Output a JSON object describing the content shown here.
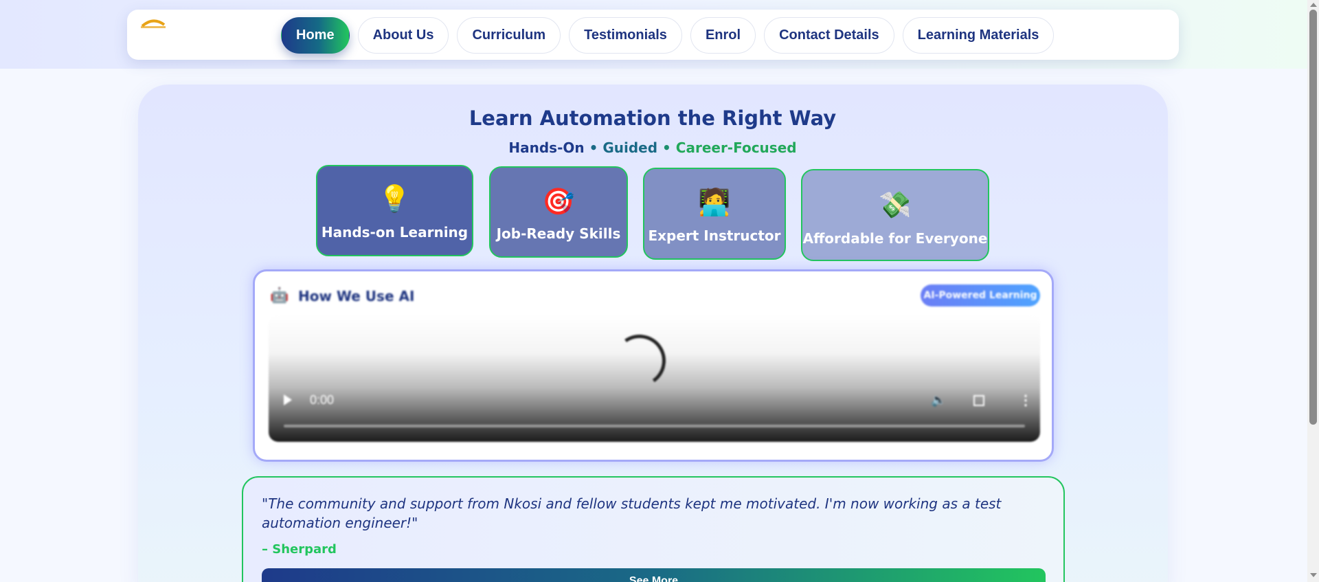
{
  "nav": {
    "items": [
      {
        "label": "Home",
        "active": true
      },
      {
        "label": "About Us"
      },
      {
        "label": "Curriculum"
      },
      {
        "label": "Testimonials"
      },
      {
        "label": "Enrol"
      },
      {
        "label": "Contact Details"
      },
      {
        "label": "Learning Materials"
      }
    ]
  },
  "hero": {
    "title": "Learn Automation the Right Way",
    "subtitle": {
      "part1": "Hands-On",
      "sep1": " • ",
      "part2": "Guided",
      "sep2": " • ",
      "part3": "Career-Focused"
    }
  },
  "features": [
    {
      "icon": "lightbulb-icon",
      "glyph": "💡",
      "label": "Hands-on Learning"
    },
    {
      "icon": "target-icon",
      "glyph": "🎯",
      "label": "Job-Ready Skills"
    },
    {
      "icon": "instructor-icon",
      "glyph": "🧑‍💻",
      "label": "Expert Instructor"
    },
    {
      "icon": "money-icon",
      "glyph": "💸",
      "label": "Affordable for Everyone"
    }
  ],
  "ai_section": {
    "icon": "robot-icon",
    "glyph": "🤖",
    "title": "How We Use AI",
    "badge": "AI-Powered Learning",
    "video": {
      "time": "0:00"
    }
  },
  "testimonial": {
    "quote": "\"The community and support from Nkosi and fellow students kept me motivated. I'm now working as a test automation engineer!\"",
    "author": "– Sherpard",
    "button": "See More"
  },
  "colors": {
    "navy": "#1e3a8a",
    "green": "#22c55e",
    "teal": "#1a6a86",
    "ai_border": "#a4a9f8"
  }
}
